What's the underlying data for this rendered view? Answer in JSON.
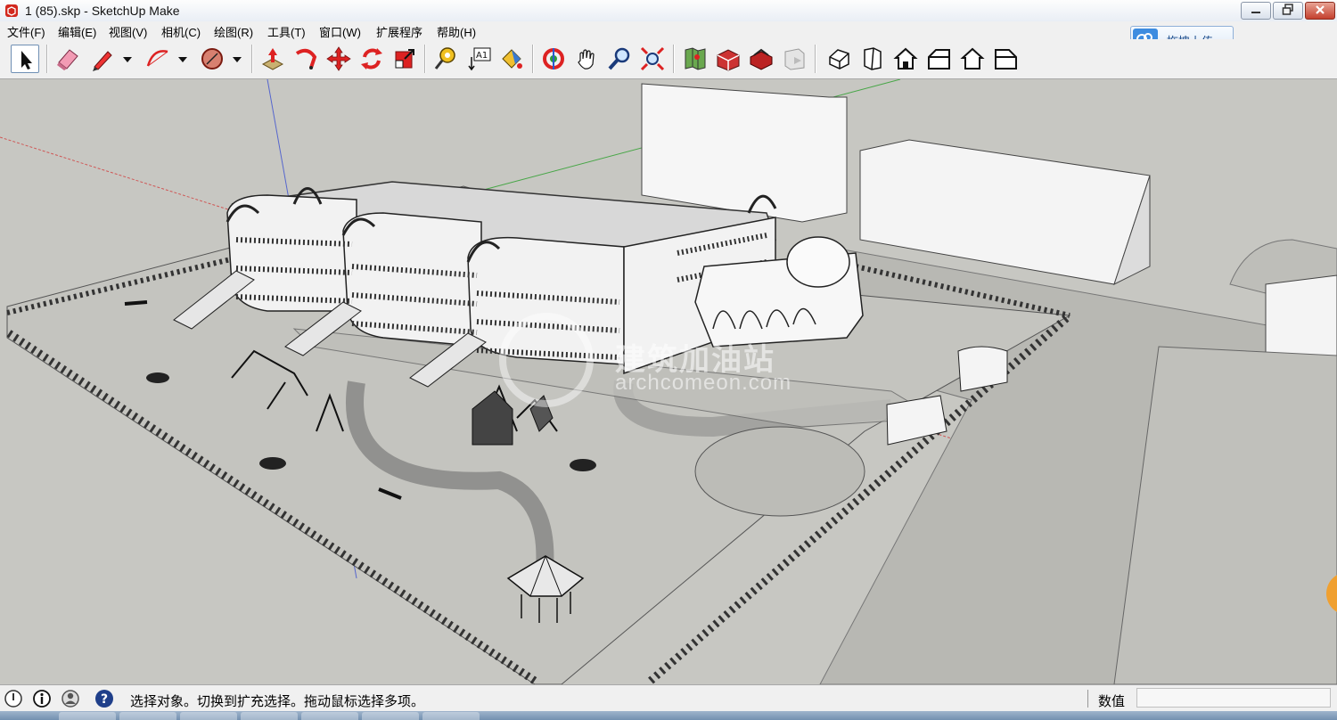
{
  "window": {
    "title": "1 (85).skp - SketchUp Make"
  },
  "menu": {
    "items": [
      {
        "label": "文件(F)"
      },
      {
        "label": "编辑(E)"
      },
      {
        "label": "视图(V)"
      },
      {
        "label": "相机(C)"
      },
      {
        "label": "绘图(R)"
      },
      {
        "label": "工具(T)"
      },
      {
        "label": "窗口(W)"
      },
      {
        "label": "扩展程序"
      },
      {
        "label": "帮助(H)"
      }
    ]
  },
  "upload": {
    "label": "拖拽上传",
    "icon": "cloud-icon"
  },
  "toolbar": {
    "tools": [
      {
        "name": "select-tool",
        "icon": "arrow-cursor-icon",
        "active": true
      },
      {
        "name": "eraser-tool",
        "icon": "eraser-icon"
      },
      {
        "name": "line-tool",
        "icon": "pencil-icon"
      },
      {
        "name": "arc-tool",
        "icon": "arc-icon"
      },
      {
        "name": "shape-tool",
        "icon": "polygon-icon"
      },
      {
        "name": "push-pull-tool",
        "icon": "push-pull-icon"
      },
      {
        "name": "follow-me-tool",
        "icon": "follow-me-icon"
      },
      {
        "name": "move-tool",
        "icon": "move-icon"
      },
      {
        "name": "rotate-tool",
        "icon": "rotate-icon"
      },
      {
        "name": "scale-tool",
        "icon": "scale-icon"
      },
      {
        "name": "tape-measure-tool",
        "icon": "tape-measure-icon"
      },
      {
        "name": "text-tool",
        "icon": "text-icon",
        "text": "A1"
      },
      {
        "name": "paint-bucket-tool",
        "icon": "paint-bucket-icon"
      },
      {
        "name": "orbit-tool",
        "icon": "orbit-icon"
      },
      {
        "name": "pan-tool",
        "icon": "hand-icon"
      },
      {
        "name": "zoom-tool",
        "icon": "magnifier-icon"
      },
      {
        "name": "zoom-extents-tool",
        "icon": "zoom-extents-icon"
      },
      {
        "name": "add-location-tool",
        "icon": "map-icon"
      },
      {
        "name": "3d-warehouse-tool",
        "icon": "warehouse-icon"
      },
      {
        "name": "extension-warehouse-tool",
        "icon": "extension-icon"
      },
      {
        "name": "layout-tool",
        "icon": "layout-icon"
      },
      {
        "name": "iso-view",
        "icon": "house-iso-icon"
      },
      {
        "name": "top-view",
        "icon": "house-top-icon"
      },
      {
        "name": "front-view",
        "icon": "house-front-icon"
      },
      {
        "name": "right-view",
        "icon": "house-right-icon"
      },
      {
        "name": "back-view",
        "icon": "house-back-icon"
      },
      {
        "name": "left-view",
        "icon": "house-left-icon"
      }
    ]
  },
  "watermark": {
    "cn": "建筑加油站",
    "en": "archcomeon.com"
  },
  "status": {
    "message": "选择对象。切换到扩充选择。拖动鼠标选择多项。",
    "measure_label": "数值",
    "measure_value": ""
  },
  "colors": {
    "sky": "#c9c9c4",
    "ground": "#c4c4bf",
    "accent": "#3d8ce0",
    "axis_red": "#d23b3b",
    "axis_green": "#3aa33a",
    "axis_blue": "#3a4fd0"
  }
}
